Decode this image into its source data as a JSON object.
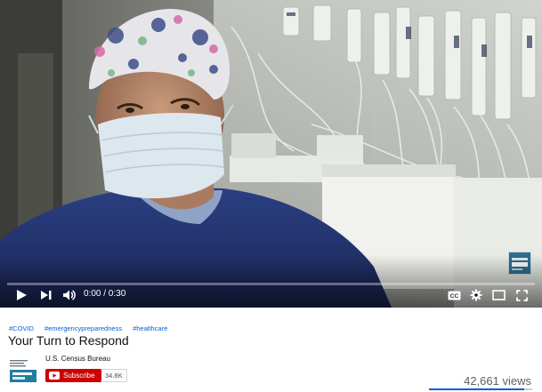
{
  "player": {
    "current_time": "0:00",
    "duration": "0:30",
    "time_display": "0:00 / 0:30",
    "progress_fraction": 0.0,
    "controls": {
      "play": "play-icon",
      "next": "next-icon",
      "volume": "volume-icon",
      "captions": "captions-icon",
      "settings": "gear-icon",
      "miniplayer": "miniplayer-icon",
      "fullscreen": "fullscreen-icon"
    },
    "watermark_text": "census",
    "accent_color": "#ff0000"
  },
  "video": {
    "hashtags": [
      "#COVID",
      "#emergencypreparedness",
      "#healthcare"
    ],
    "title": "Your Turn to Respond",
    "view_count": "42,661 views",
    "like_fraction": 0.92
  },
  "channel": {
    "name": "U.S. Census Bureau",
    "avatar_logo_text": "Census 2020",
    "avatar_tagline": "Shape your future START HERE",
    "subscribe_label": "Subscribe",
    "subscriber_count": "34.8K",
    "subscribe_color": "#cc0000"
  }
}
